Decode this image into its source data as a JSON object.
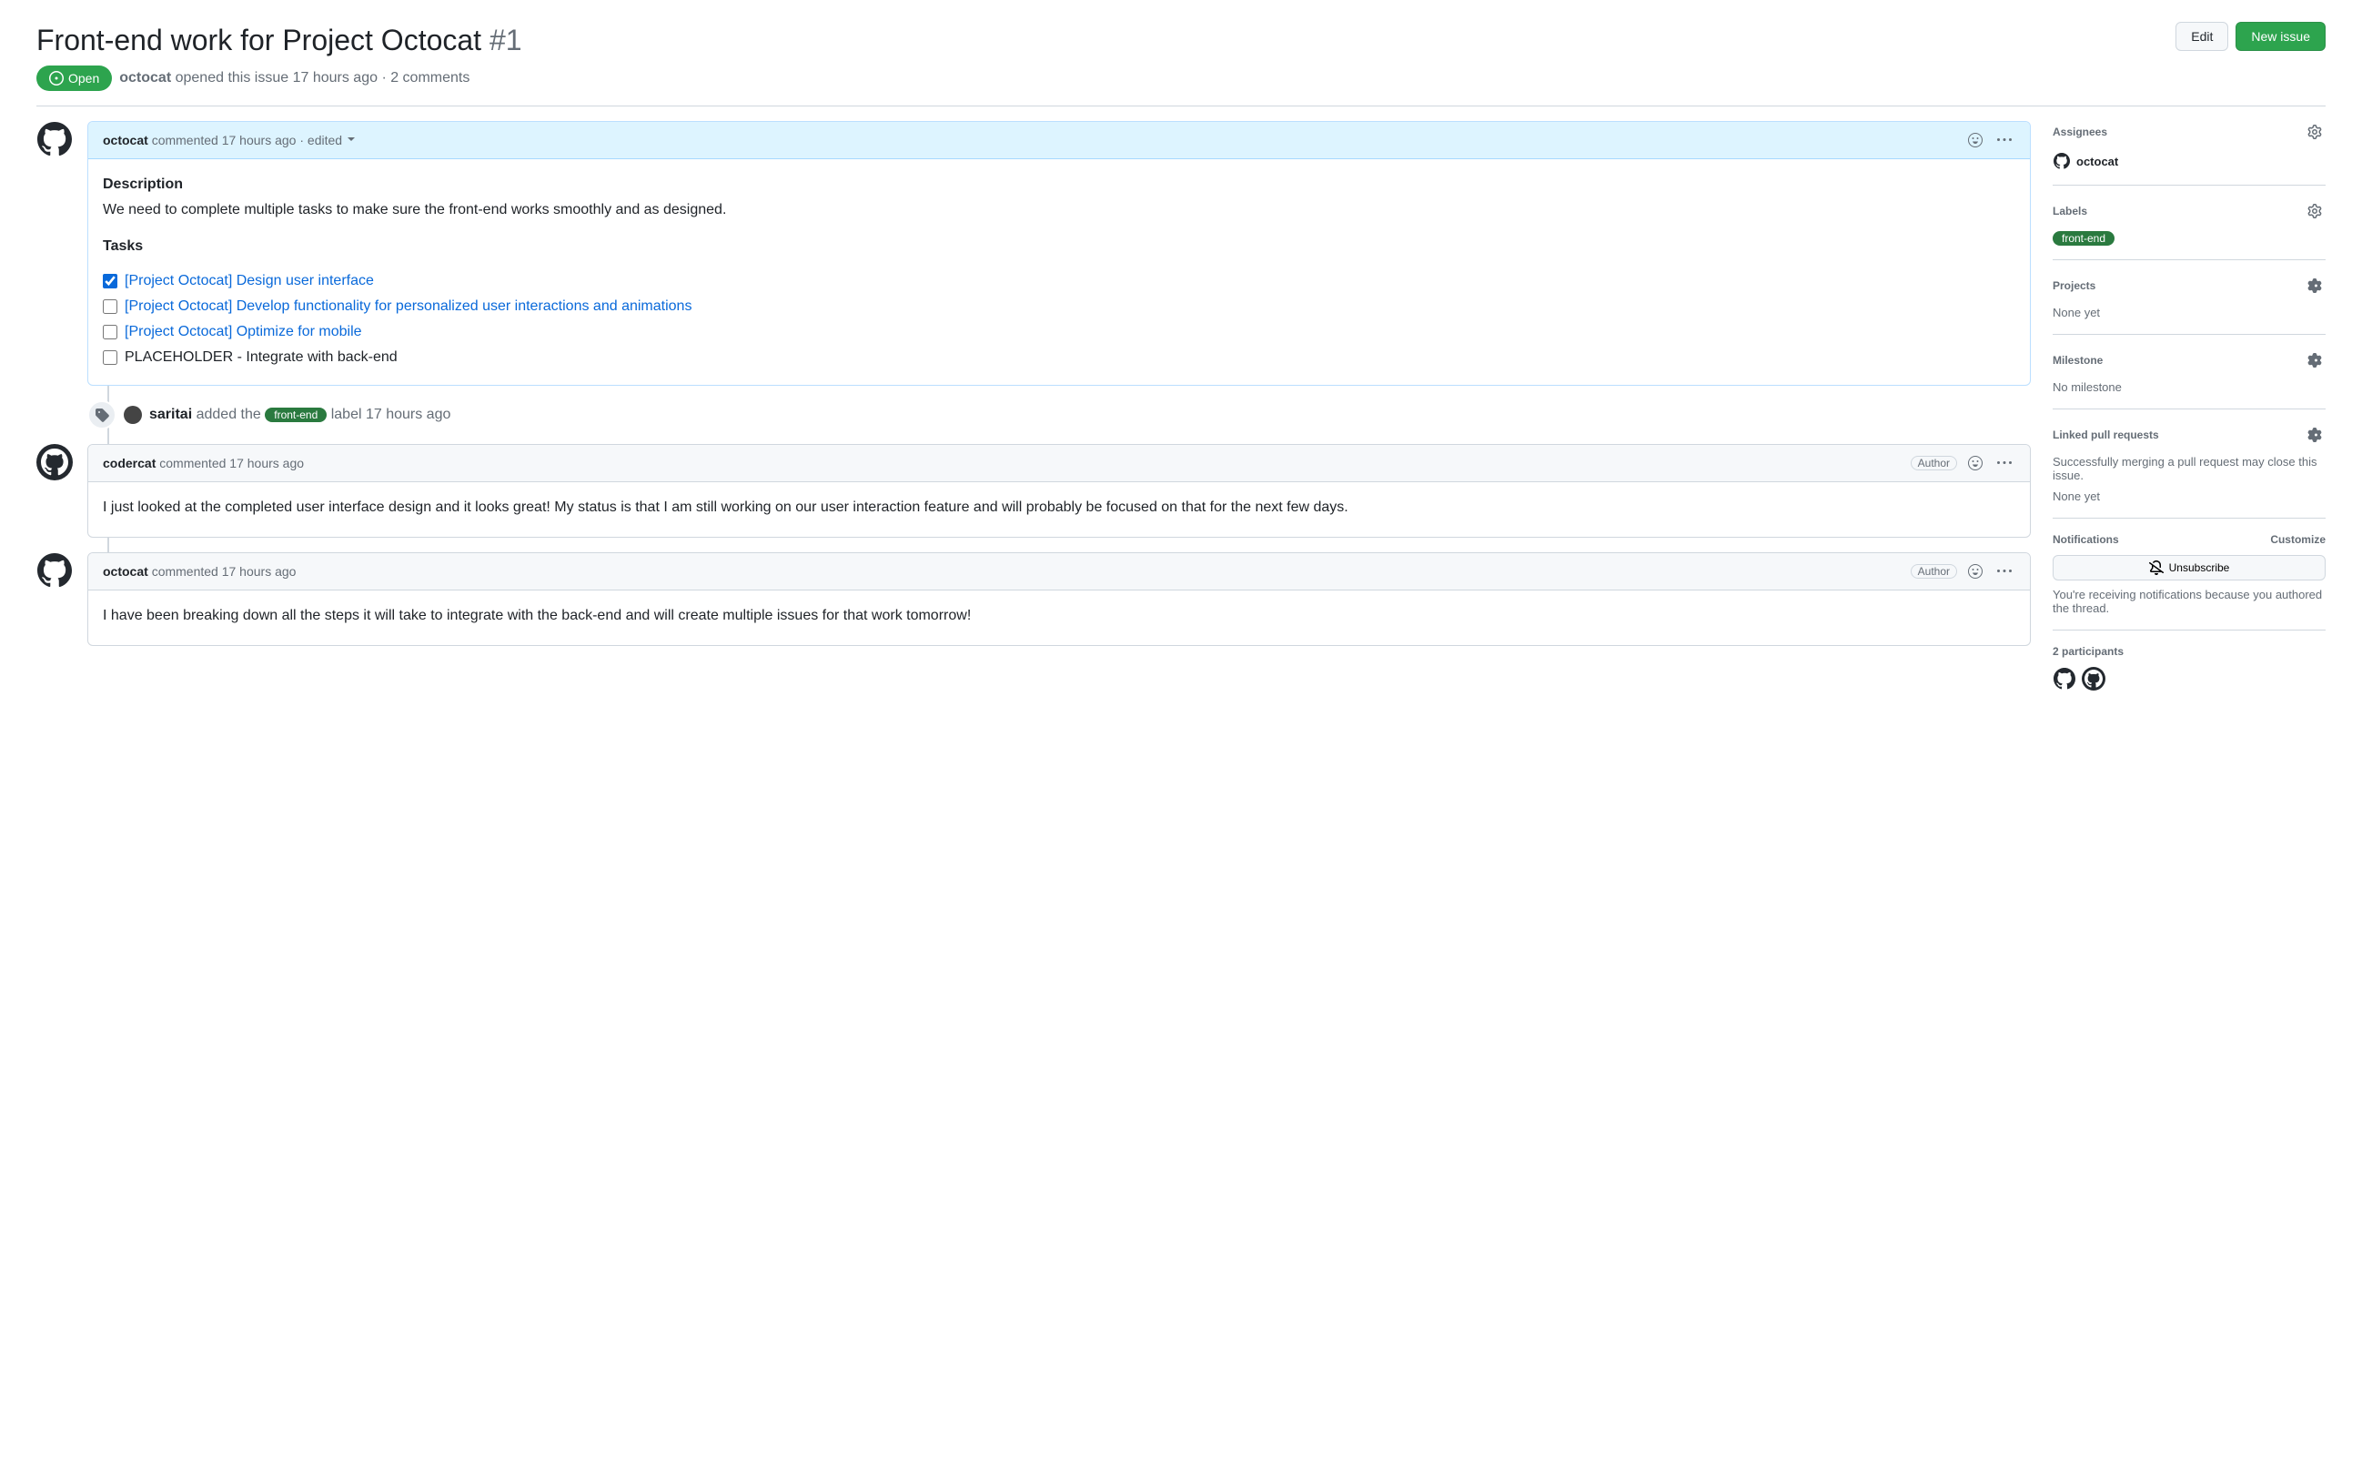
{
  "header": {
    "title": "Front-end work for Project Octocat",
    "issue_number": "#1",
    "edit_label": "Edit",
    "new_issue_label": "New issue"
  },
  "meta": {
    "state": "Open",
    "author": "octocat",
    "opened_text": "opened this issue 17 hours ago · 2 comments"
  },
  "comments": [
    {
      "author": "octocat",
      "action": "commented 17 hours ago",
      "edited": "edited",
      "body": {
        "description_heading": "Description",
        "description_text": "We need to complete multiple tasks to make sure the front-end works smoothly and as designed.",
        "tasks_heading": "Tasks",
        "tasks": [
          {
            "checked": true,
            "label": "[Project Octocat] Design user interface",
            "link": true
          },
          {
            "checked": false,
            "label": "[Project Octocat] Develop functionality for personalized user interactions and animations",
            "link": true
          },
          {
            "checked": false,
            "label": "[Project Octocat] Optimize for mobile",
            "link": true
          },
          {
            "checked": false,
            "label": "PLACEHOLDER - Integrate with back-end",
            "link": false
          }
        ]
      }
    },
    {
      "author": "codercat",
      "action": "commented 17 hours ago",
      "author_badge": "Author",
      "body_text": "I just looked at the completed user interface design and it looks great! My status is that I am still working on our user interaction feature and will probably be focused on that for the next few days."
    },
    {
      "author": "octocat",
      "action": "commented 17 hours ago",
      "author_badge": "Author",
      "body_text": "I have been breaking down all the steps it will take to integrate with the back-end and will create multiple issues for that work tomorrow!"
    }
  ],
  "event": {
    "user": "saritai",
    "added_the": "added the",
    "label": "front-end",
    "suffix": "label 17 hours ago"
  },
  "sidebar": {
    "assignees": {
      "title": "Assignees",
      "user": "octocat"
    },
    "labels": {
      "title": "Labels",
      "label": "front-end"
    },
    "projects": {
      "title": "Projects",
      "none": "None yet"
    },
    "milestone": {
      "title": "Milestone",
      "none": "No milestone"
    },
    "linked_prs": {
      "title": "Linked pull requests",
      "desc": "Successfully merging a pull request may close this issue.",
      "none": "None yet"
    },
    "notifications": {
      "title": "Notifications",
      "customize": "Customize",
      "unsubscribe": "Unsubscribe",
      "reason": "You're receiving notifications because you authored the thread."
    },
    "participants": {
      "title": "2 participants"
    }
  }
}
